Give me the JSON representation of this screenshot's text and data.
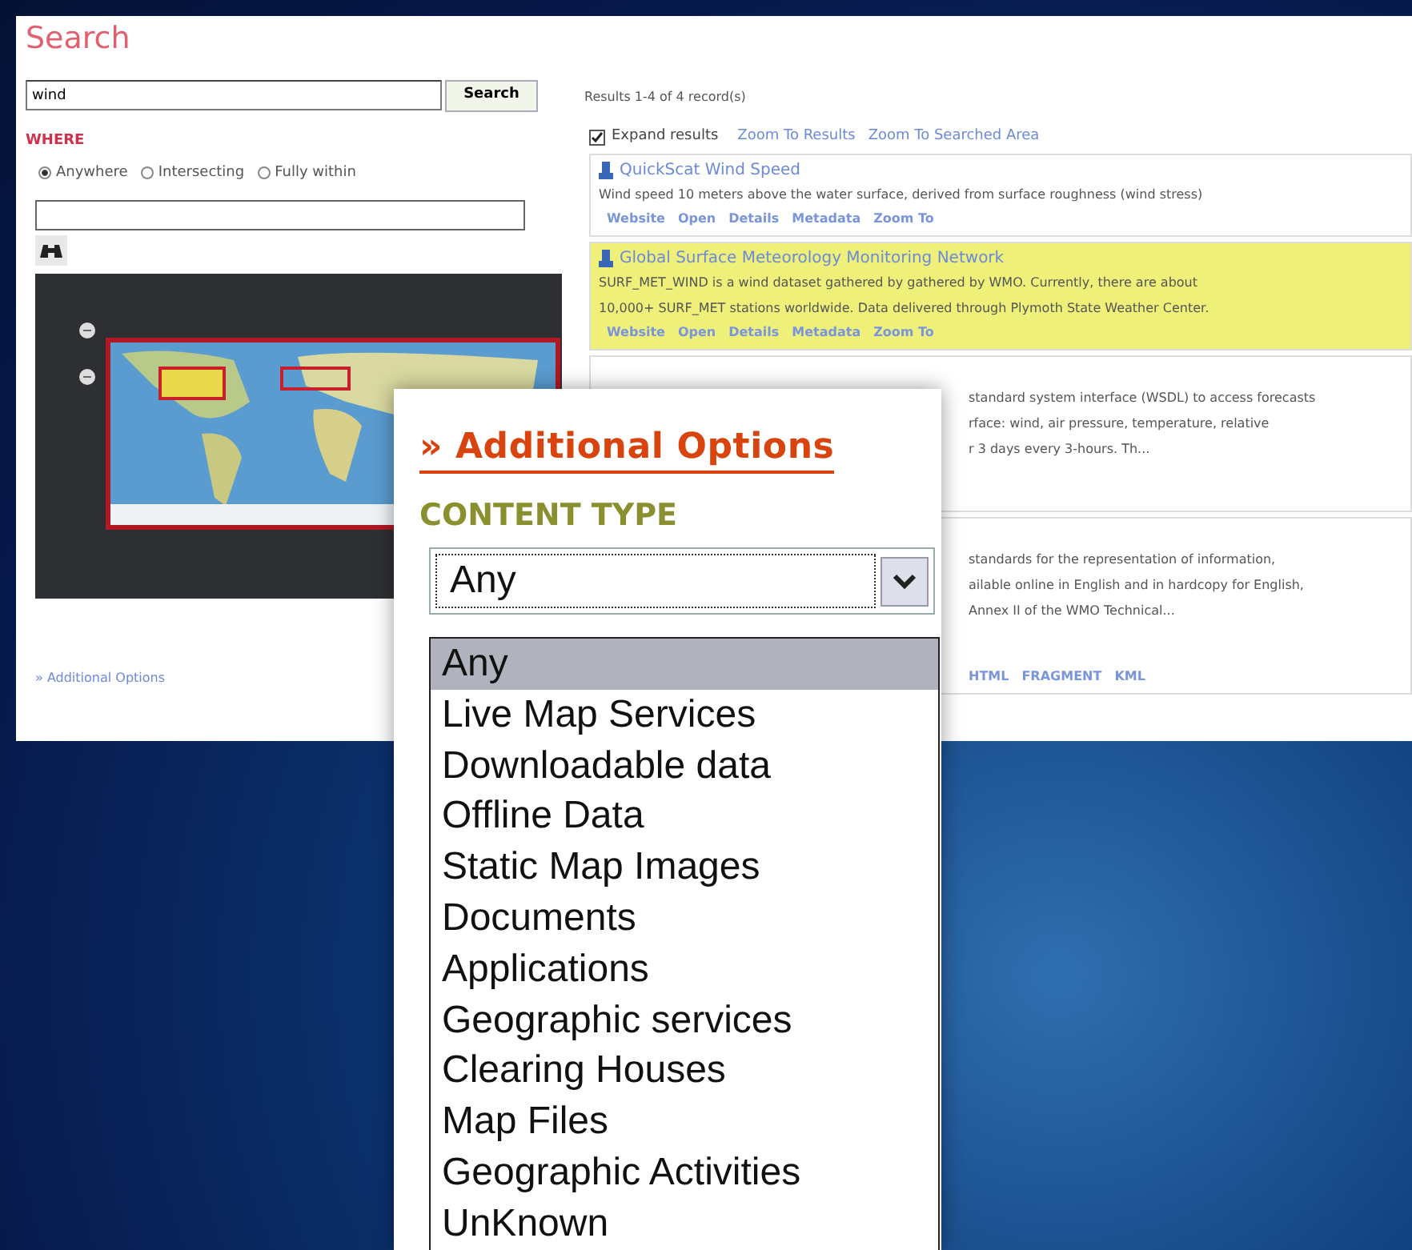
{
  "search_page": {
    "title": "Search",
    "query": "wind",
    "search_button": "Search",
    "where_label": "WHERE",
    "where_options": [
      {
        "label": "Anywhere",
        "selected": true
      },
      {
        "label": "Intersecting",
        "selected": false
      },
      {
        "label": "Fully within",
        "selected": false
      }
    ],
    "additional_options_link": "» Additional Options"
  },
  "results": {
    "summary": "Results 1-4 of 4 record(s)",
    "expand": {
      "label": "Expand results",
      "checked": true
    },
    "links": [
      "Zoom To Results",
      "Zoom To Searched Area"
    ],
    "items": [
      {
        "kind": "full",
        "title": "QuickScat Wind Speed",
        "highlighted": false,
        "lines": [
          "Wind speed 10 meters above the water surface, derived from surface roughness (wind stress)"
        ],
        "actions": [
          "Website",
          "Open",
          "Details",
          "Metadata",
          "Zoom To"
        ]
      },
      {
        "kind": "full",
        "title": "Global Surface Meteorology Monitoring Network",
        "highlighted": true,
        "lines": [
          "SURF_MET_WIND is a wind dataset gathered by gathered by WMO. Currently, there are about",
          "10,000+ SURF_MET stations worldwide. Data delivered through Plymoth State Weather Center."
        ],
        "actions": [
          "Website",
          "Open",
          "Details",
          "Metadata",
          "Zoom To"
        ]
      },
      {
        "kind": "covered",
        "highlighted": false,
        "lines": [
          "standard system interface (WSDL) to access forecasts",
          "rface: wind, air pressure, temperature, relative",
          "r 3 days every 3-hours. Th..."
        ]
      },
      {
        "kind": "covered",
        "highlighted": false,
        "lines": [
          "standards for the representation of information,",
          "ailable online in English and in hardcopy for English,",
          "Annex II of the WMO Technical..."
        ],
        "actions": [
          "HTML",
          "FRAGMENT",
          "KML"
        ]
      }
    ]
  },
  "additional_options": {
    "heading": "» Additional Options",
    "content_type_label": "CONTENT TYPE",
    "select": {
      "value": "Any",
      "options": [
        {
          "label": "Any",
          "selected": true
        },
        {
          "label": "Live Map Services",
          "selected": false
        },
        {
          "label": "Downloadable data",
          "selected": false
        },
        {
          "label": "Offline Data",
          "selected": false
        },
        {
          "label": "Static Map Images",
          "selected": false
        },
        {
          "label": "Documents",
          "selected": false
        },
        {
          "label": "Applications",
          "selected": false
        },
        {
          "label": "Geographic services",
          "selected": false
        },
        {
          "label": "Clearing Houses",
          "selected": false
        },
        {
          "label": "Map Files",
          "selected": false
        },
        {
          "label": "Geographic Activities",
          "selected": false
        },
        {
          "label": "UnKnown",
          "selected": false
        }
      ]
    }
  }
}
